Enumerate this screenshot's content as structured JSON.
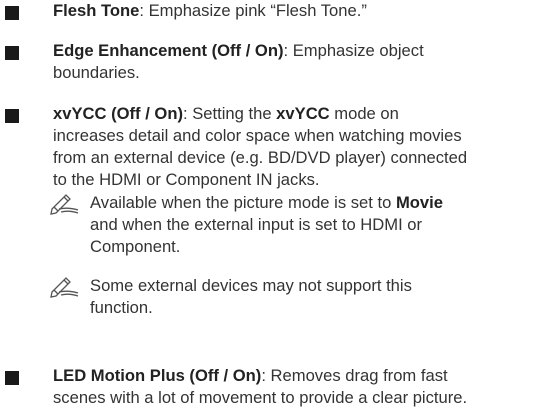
{
  "items": [
    {
      "term": "Flesh Tone",
      "text": ": Emphasize pink “Flesh Tone.”"
    },
    {
      "term": "Edge Enhancement (Off / On)",
      "text_lines": [
        ": Emphasize object",
        "boundaries."
      ]
    },
    {
      "term": "xvYCC (Off / On)",
      "line1_a": ": Setting the ",
      "line1_b": "xvYCC",
      "line1_c": " mode on",
      "lines": [
        "increases detail and color space when watching movies",
        "from an external device (e.g. BD/DVD player) connected",
        "to the HDMI or Component IN jacks."
      ]
    },
    {
      "term": "LED Motion Plus (Off / On)",
      "line1": ": Removes drag from fast",
      "line2": "scenes with a lot of movement to provide a clear picture."
    }
  ],
  "notes": [
    {
      "line1_a": "Available when the picture mode is set to ",
      "line1_b": "Movie",
      "line2": "and when the external input is set to HDMI or",
      "line3": "Component.",
      "icon": "note-pencil-icon"
    },
    {
      "line1": "Some external devices may not support this",
      "line2": "function.",
      "icon": "note-pencil-icon"
    }
  ]
}
